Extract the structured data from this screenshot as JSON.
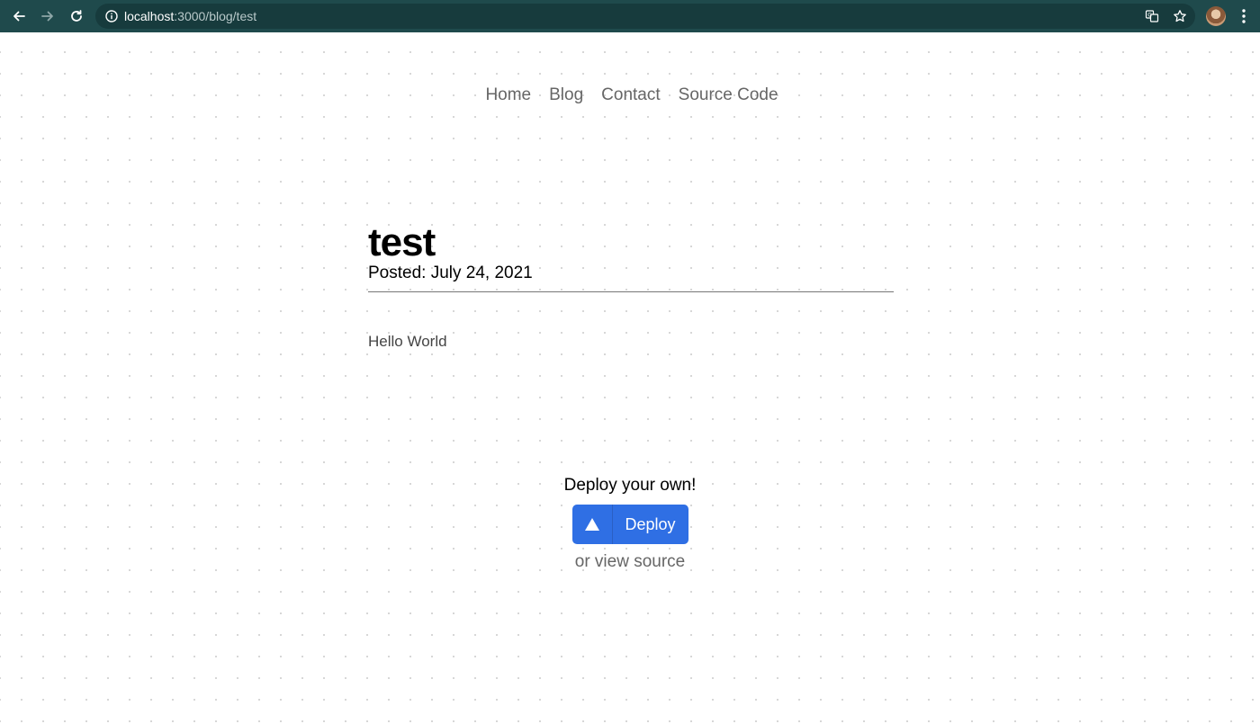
{
  "browser": {
    "url_host": "localhost",
    "url_path": ":3000/blog/test"
  },
  "nav": {
    "items": [
      {
        "label": "Home"
      },
      {
        "label": "Blog"
      },
      {
        "label": "Contact"
      },
      {
        "label": "Source Code"
      }
    ]
  },
  "post": {
    "title": "test",
    "date": "Posted: July 24, 2021",
    "body": "Hello World"
  },
  "deploy": {
    "heading": "Deploy your own!",
    "button_label": "Deploy",
    "source_link": "or view source"
  },
  "colors": {
    "browser_bar": "#1f4a4c",
    "deploy_button": "#2f6fe4",
    "nav_text": "#666666"
  }
}
